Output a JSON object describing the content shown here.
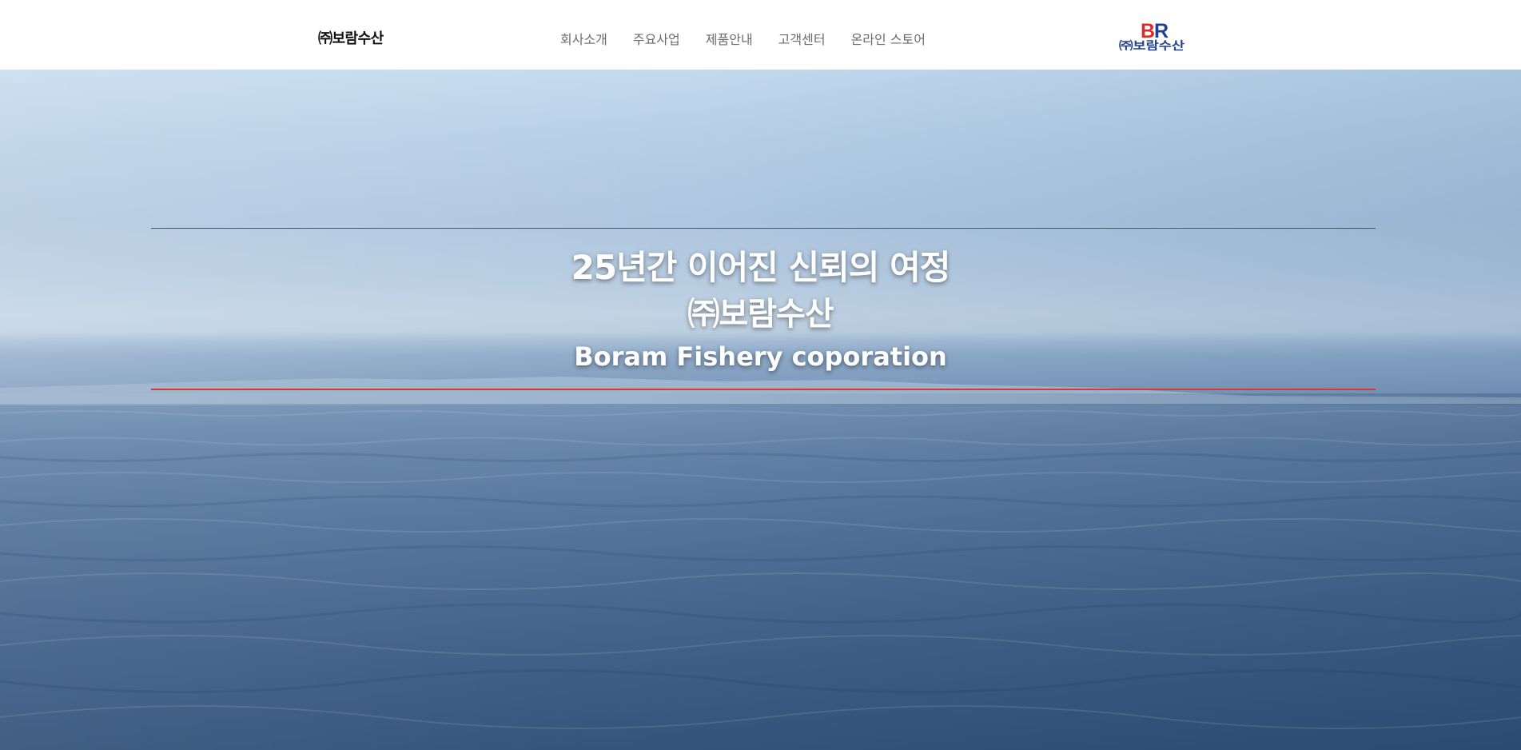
{
  "header": {
    "brand": "㈜보람수산",
    "nav": [
      {
        "label": "회사소개"
      },
      {
        "label": "주요사업"
      },
      {
        "label": "제품안내"
      },
      {
        "label": "고객센터"
      },
      {
        "label": "온라인 스토어"
      }
    ],
    "logo": {
      "mark": "BR",
      "label": "㈜보람수산",
      "mark_colors": [
        "#e02a2a",
        "#1f3f8f"
      ]
    }
  },
  "hero": {
    "headline": "25년간 이어진 신뢰의 여정",
    "subtitle": "㈜보람수산",
    "english": "Boram Fishery coporation",
    "rule_top_color": "#3b53a5",
    "rule_bottom_color": "#d43a30"
  }
}
